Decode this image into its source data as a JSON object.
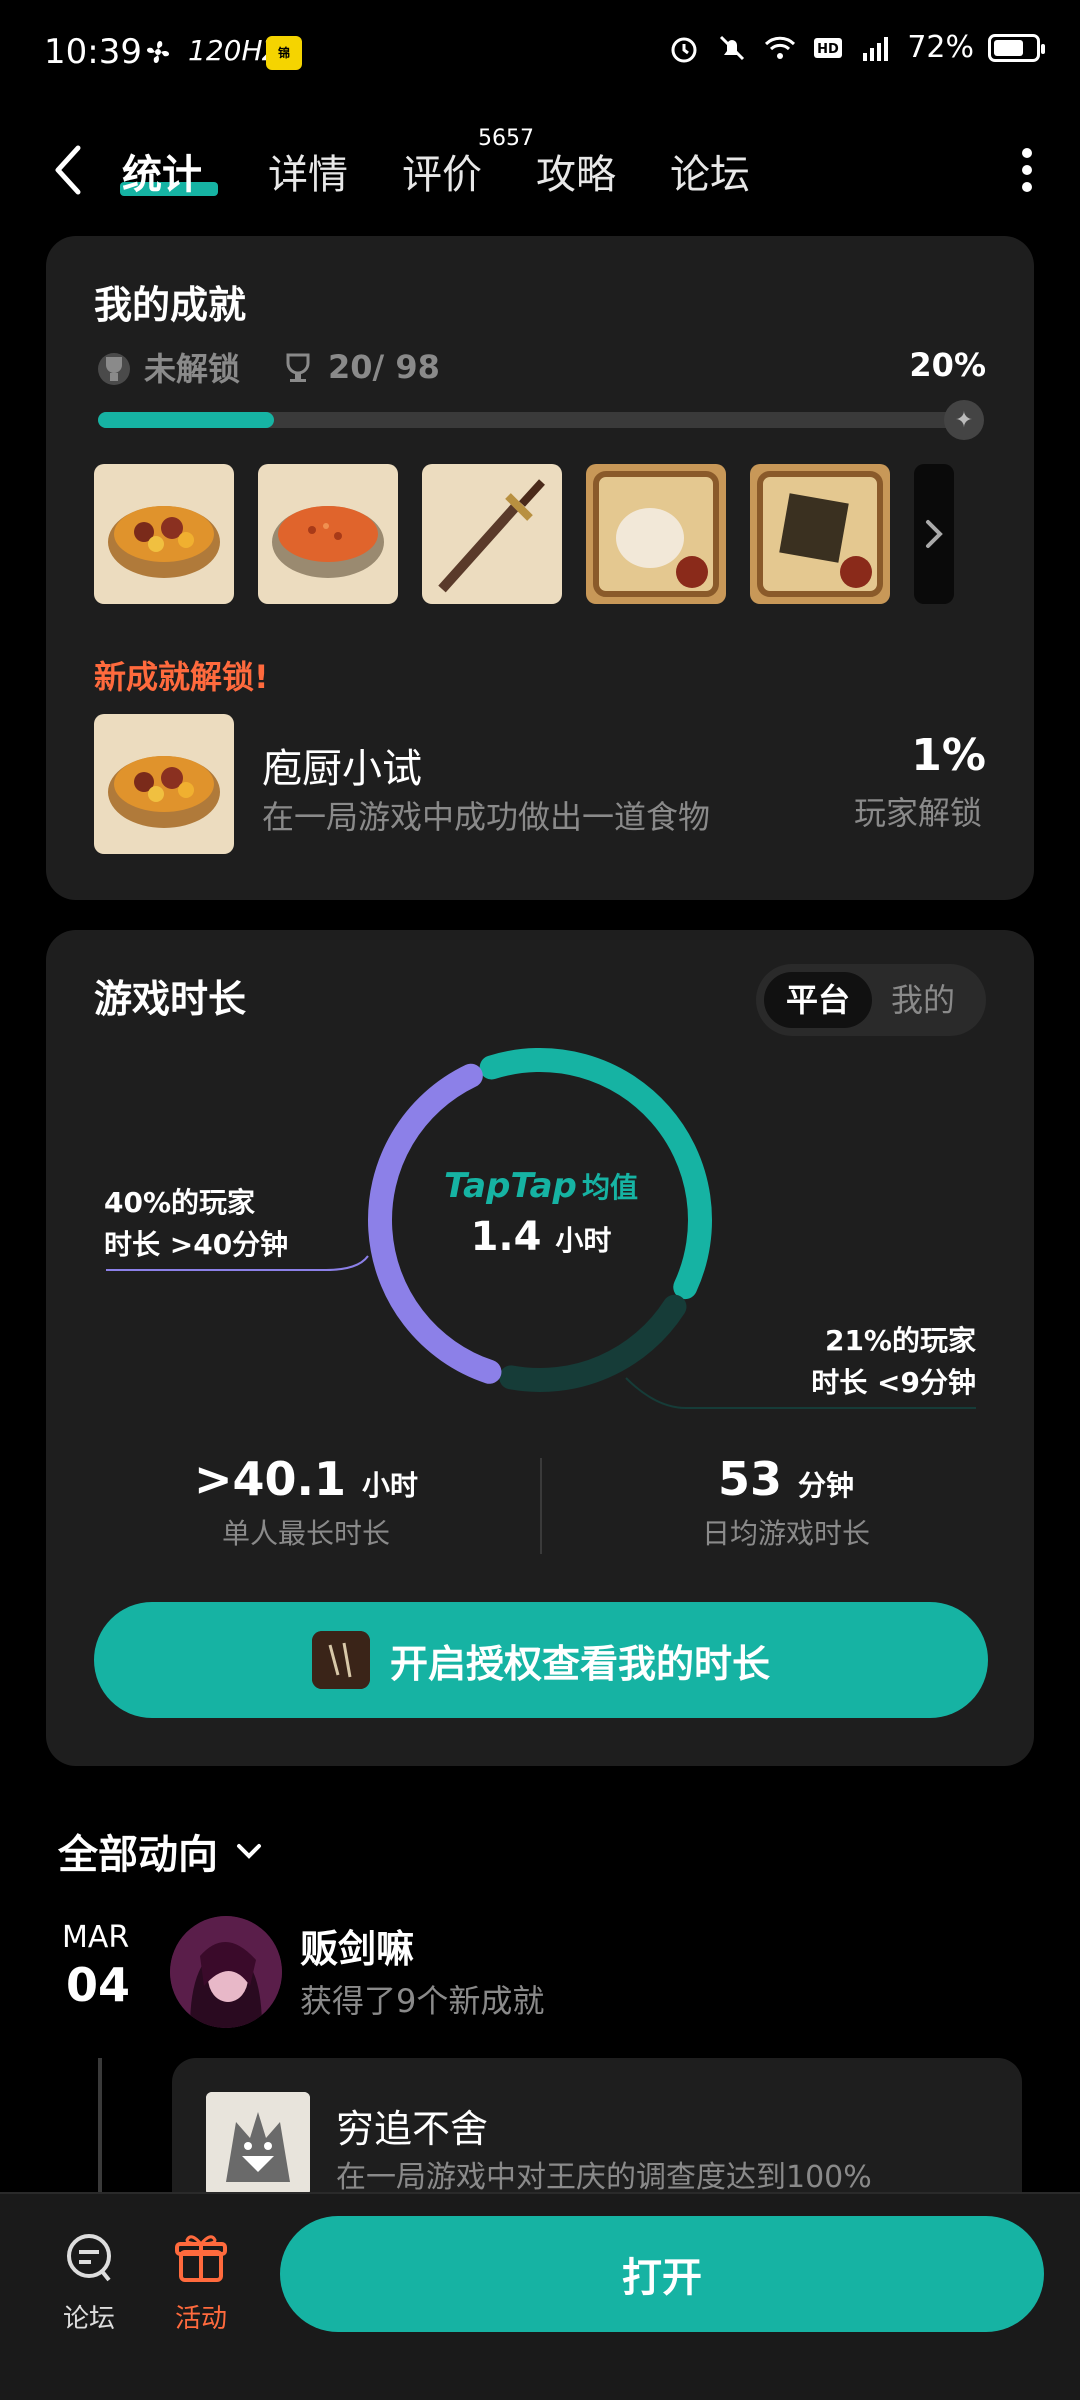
{
  "status_bar": {
    "time": "10:39",
    "refresh": "120HZ",
    "battery": "72%",
    "battery_level": 0.72
  },
  "nav": {
    "tabs": [
      {
        "label": "统计",
        "active": true
      },
      {
        "label": "详情",
        "active": false
      },
      {
        "label": "评价",
        "active": false,
        "badge": "5657"
      },
      {
        "label": "攻略",
        "active": false
      },
      {
        "label": "论坛",
        "active": false
      }
    ]
  },
  "achievements": {
    "title": "我的成就",
    "locked_label": "未解锁",
    "count": "20/ 98",
    "percent": "20%",
    "progress": 0.2,
    "new_unlock_label": "新成就解锁!",
    "featured": {
      "name": "庖厨小试",
      "description": "在一局游戏中成功做出一道食物",
      "percent": "1%",
      "percent_label": "玩家解锁"
    }
  },
  "playtime": {
    "title": "游戏时长",
    "toggle": {
      "selected": "平台",
      "other": "我的"
    },
    "center_brand": "TapTap",
    "center_label": "均值",
    "center_value": "1.4",
    "center_unit": "小时",
    "note_left_line1": "40%的玩家",
    "note_left_line2": "时长 >40分钟",
    "note_right_line1": "21%的玩家",
    "note_right_line2": "时长 <9分钟",
    "stat_left_value": ">40.1",
    "stat_left_unit": "小时",
    "stat_left_label": "单人最长时长",
    "stat_right_value": "53",
    "stat_right_unit": "分钟",
    "stat_right_label": "日均游戏时长",
    "auth_button": "开启授权查看我的时长",
    "ring_shares": {
      "purple": 0.4,
      "teal": 0.39,
      "dark": 0.21
    },
    "colors": {
      "purple": "#8c80e8",
      "teal": "#16b3a3",
      "dark": "#163c38"
    }
  },
  "feed": {
    "header": "全部动向",
    "month": "MAR",
    "day": "04",
    "user": "贩剑嘛",
    "action": "获得了9个新成就",
    "card_name": "穷追不舍",
    "card_desc": "在一局游戏中对王庆的调查度达到100%"
  },
  "bottom": {
    "forum_label": "论坛",
    "activity_label": "活动",
    "open_button": "打开"
  },
  "colors": {
    "accent": "#16b3a3",
    "highlight": "#ff6a3d",
    "card_bg": "#1e1e1e"
  }
}
